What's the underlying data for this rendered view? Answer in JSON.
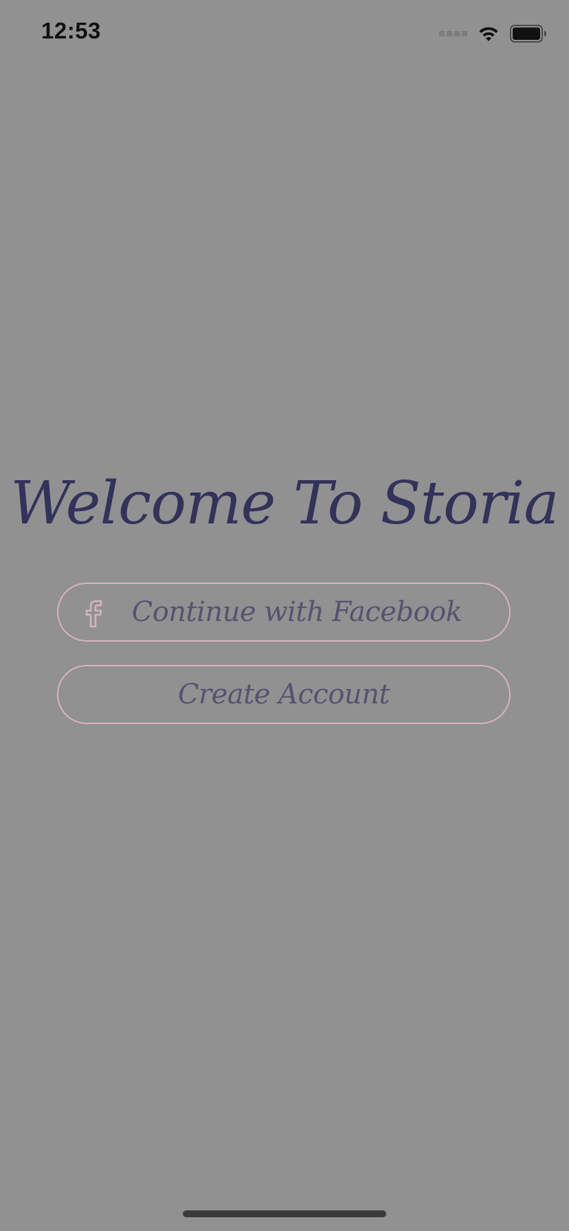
{
  "status_bar": {
    "time": "12:53"
  },
  "main": {
    "title": "Welcome To Storia",
    "facebook_button_label": "Continue with Facebook",
    "create_account_label": "Create Account"
  },
  "icons": {
    "facebook": "facebook-icon",
    "wifi": "wifi-icon",
    "battery": "battery-icon",
    "signal": "signal-icon"
  },
  "colors": {
    "background": "#919191",
    "title": "#33325a",
    "button_border": "#d9b3bf",
    "button_text": "#57526f",
    "facebook_icon": "#d9b3bf"
  }
}
